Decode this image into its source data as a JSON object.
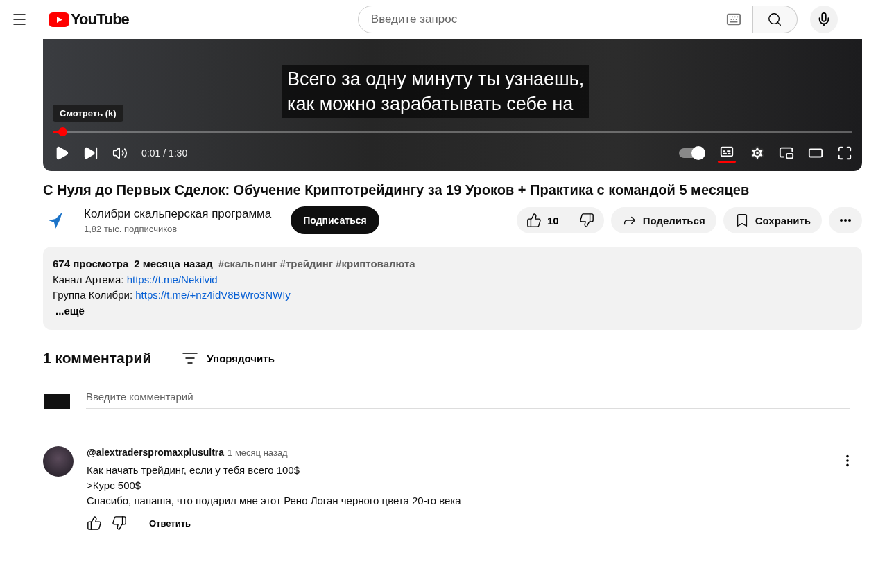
{
  "header": {
    "logo": "YouTube",
    "search": {
      "placeholder": "Введите запрос"
    }
  },
  "player": {
    "subtitle_lines": [
      "Всего за одну минуту ты узнаешь,",
      "как можно зарабатывать себе на"
    ],
    "tooltip": "Смотреть (k)",
    "progress": {
      "level": 0.012
    },
    "time": "0:01 / 1:30",
    "subtitles_on": true,
    "autoplay_on": true
  },
  "video": {
    "title": "С Нуля до Первых Сделок: Обучение Криптотрейдингу за 19 Уроков + Практика с командой 5 месяцев",
    "channel": {
      "name": "Колибри скальперская программа",
      "subscribers": "1,82 тыс. подписчиков",
      "subscribe": "Подписаться"
    },
    "likes": "10",
    "share": "Поделиться",
    "save": "Сохранить"
  },
  "description": {
    "views": "674 просмотра",
    "date": "2 месяца назад",
    "tags": [
      "#скальпинг",
      "#трейдинг",
      "#криптовалюта"
    ],
    "links": [
      {
        "label": "Канал Артема: ",
        "url": "https://t.me/Nekilvid"
      },
      {
        "label": "Группа Колибри: ",
        "url": "https://t.me/+nz4idV8BWro3NWIy"
      }
    ],
    "more": "...ещё"
  },
  "comments": {
    "count": "1 комментарий",
    "sort": "Упорядочить",
    "input": {
      "placeholder": "Введите комментарий"
    },
    "items": [
      {
        "author": "@alextraderspromaxplusultra",
        "time": "1 месяц назад",
        "lines": [
          "Как начать трейдинг, если у тебя всего 100$",
          ">Курс 500$",
          "Спасибо, папаша, что подарил мне этот Рено Логан черного цвета 20-го века"
        ],
        "reply": "Ответить"
      }
    ]
  }
}
